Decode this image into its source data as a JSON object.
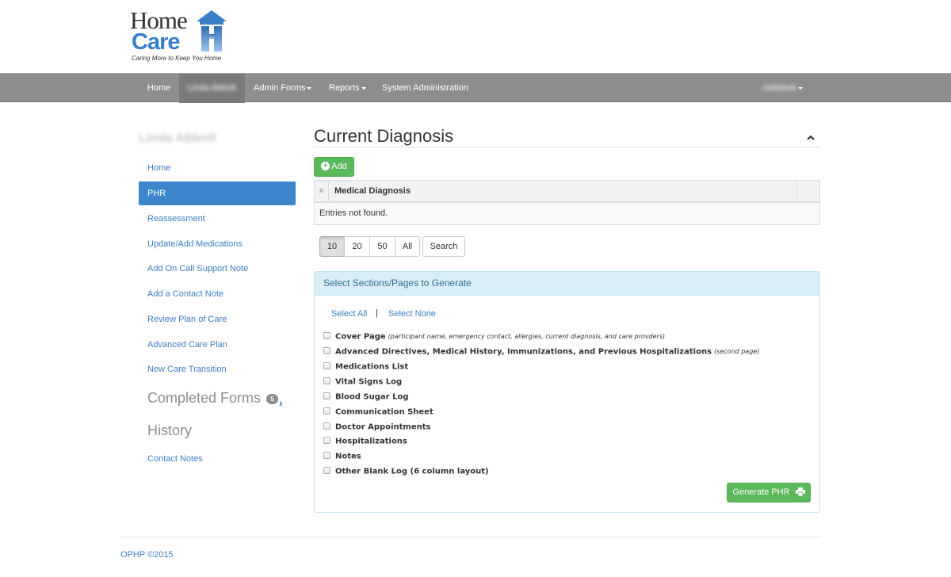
{
  "brand": {
    "logo_home": "Home",
    "logo_care": "Care",
    "tagline": "Caring More to Keep You Home",
    "accent_color": "#3a7ec8"
  },
  "navbar": {
    "items": [
      {
        "label": "Home"
      },
      {
        "label": "Linda Abbott",
        "active": true,
        "obscured": true
      },
      {
        "label": "Admin Forms",
        "dropdown": true
      },
      {
        "label": "Reports",
        "dropdown": true
      },
      {
        "label": "System Administration"
      }
    ],
    "user_menu": {
      "label": "robbiesk",
      "obscured": true,
      "dropdown": true
    }
  },
  "sidebar": {
    "user_name": "Linda Abbott",
    "links": [
      {
        "label": "Home"
      },
      {
        "label": "PHR",
        "active": true
      },
      {
        "label": "Reassessment"
      },
      {
        "label": "Update/Add Medications"
      },
      {
        "label": "Add On Call Support Note"
      },
      {
        "label": "Add a Contact Note"
      },
      {
        "label": "Review Plan of Care"
      },
      {
        "label": "Advanced Care Plan"
      },
      {
        "label": "New Care Transition"
      }
    ],
    "completed_forms": {
      "label": "Completed Forms",
      "count": "5",
      "icon": "chevron-right-icon"
    },
    "history": {
      "label": "History"
    },
    "history_links": [
      {
        "label": "Contact Notes"
      }
    ]
  },
  "main": {
    "title": "Current Diagnosis",
    "collapse_icon": "chevron-up-icon",
    "add_button": {
      "label": "Add",
      "icon": "plus-circle-icon"
    },
    "table": {
      "columns": [
        "#",
        "Medical Diagnosis"
      ],
      "empty_text": "Entries not found."
    },
    "pagination": {
      "sizes": [
        "10",
        "20",
        "50",
        "All"
      ],
      "selected": "10",
      "search_label": "Search"
    },
    "sections_panel": {
      "title": "Select Sections/Pages to Generate",
      "select_all": "Select All",
      "separator": "|",
      "select_none": "Select None",
      "options": [
        {
          "label": "Cover Page",
          "note": "(participant name, emergency contact, allergies, current diagnosis, and care provders)",
          "checked": false
        },
        {
          "label": "Advanced Directives, Medical History, Immunizations, and Previous Hospitalizations",
          "note": "(second page)",
          "checked": false
        },
        {
          "label": "Medications List",
          "note": "",
          "checked": false
        },
        {
          "label": "Vital Signs Log",
          "note": "",
          "checked": false
        },
        {
          "label": "Blood Sugar Log",
          "note": "",
          "checked": false
        },
        {
          "label": "Communication Sheet",
          "note": "",
          "checked": false
        },
        {
          "label": "Doctor Appointments",
          "note": "",
          "checked": false
        },
        {
          "label": "Hospitalizations",
          "note": "",
          "checked": false
        },
        {
          "label": "Notes",
          "note": "",
          "checked": false
        },
        {
          "label": "Other Blank Log (6 column layout)",
          "note": "",
          "checked": false
        }
      ],
      "generate_button": {
        "label": "Generate PHR",
        "icon": "printer-icon"
      }
    }
  },
  "footer": {
    "text": "OPHP ©2015"
  }
}
